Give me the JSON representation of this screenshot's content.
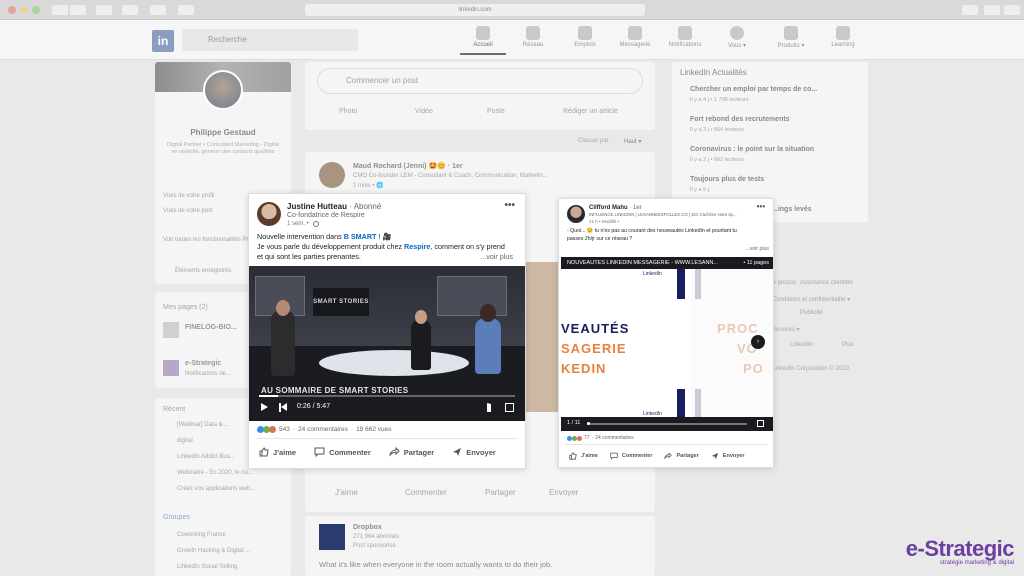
{
  "browser": {
    "url": "linkedin.com"
  },
  "linkedin": {
    "logo": "in",
    "search_placeholder": "Recherche",
    "nav": [
      {
        "label": "Accueil",
        "icon": "home-icon"
      },
      {
        "label": "Réseau",
        "icon": "network-icon"
      },
      {
        "label": "Emplois",
        "icon": "jobs-icon"
      },
      {
        "label": "Messagerie",
        "icon": "messaging-icon"
      },
      {
        "label": "Notifications",
        "icon": "bell-icon"
      },
      {
        "label": "Vous ▾",
        "icon": "avatar-icon"
      },
      {
        "label": "Produits ▾",
        "icon": "grid-icon"
      },
      {
        "label": "Learning",
        "icon": "learning-icon"
      }
    ]
  },
  "left_profile": {
    "name": "Philippe Gestaud",
    "headline": "Digital Partner • Consultant Marketing - Digital en visibilité, générer des contacts qualifiés",
    "stats": [
      "Vues de votre profil",
      "Vues de votre post"
    ],
    "premium": "Voir toutes les fonctionnalités Premium",
    "saved": "Éléments enregistrés",
    "pages_title": "Mes pages (2)",
    "pages": [
      "FINELOG-BIO...",
      "e-Strategic"
    ],
    "pages_sub": "Notifications de...",
    "recent_title": "Récent",
    "recent": [
      "[Webinar] Data & ...",
      "digital",
      "LinkedIn Addict Bus...",
      "Webinaire - En 2020, le no...",
      "Créez vos applications web..."
    ],
    "groups_title": "Groupes",
    "groups": [
      "Coworking France",
      "Growth Hacking & Digital ...",
      "LinkedIn Social Selling"
    ]
  },
  "composer": {
    "start_post": "Commencer un post",
    "photo": "Photo",
    "video": "Vidéo",
    "event": "Poste",
    "article": "Rédiger un article",
    "sort_label": "Classer par :",
    "sort_value": "Haut ▾"
  },
  "bg_post": {
    "author": "Maud Rochard (Jenni) 🤩😊 · 1er",
    "subtitle": "CMO Co-founder LEM - Consultant & Coach, Communication, Marketin...",
    "time": "1 mois • 🌐"
  },
  "bg_actions": [
    "J'aime",
    "Commenter",
    "Partager",
    "Envoyer"
  ],
  "dropbox": {
    "name": "Dropbox",
    "followers": "271 964 abonnés",
    "sponsored": "Post sponsorisé",
    "text": "What it's like when everyone in the room actually wants to do their job."
  },
  "right_news": {
    "title": "LinkedIn Actualités",
    "items": [
      {
        "title": "Chercher un emploi par temps de co...",
        "meta": "Il y a 4 j • 1 709 lecteurs"
      },
      {
        "title": "Fort rebond des recrutements",
        "meta": "Il y a 3 j • 664 lecteurs"
      },
      {
        "title": "Coronavirus : le point sur la situation",
        "meta": "Il y a 2 j • 662 lecteurs"
      },
      {
        "title": "Toujours plus de tests",
        "meta": "Il y a 5 j"
      },
      {
        "title": "...ings levés",
        "meta": ""
      }
    ],
    "footer_links": [
      "À propos",
      "Assistance clientèle",
      "Conditions et confidentialité ▾",
      "Publicité",
      "Services ▾",
      "LinkedIn",
      "Plus",
      "LinkedIn Corporation © 2020"
    ]
  },
  "post1": {
    "author": "Justine Hutteau",
    "follow": "· Abonné",
    "subtitle": "Co-fondatrice de Respire",
    "time": "1 sem. •",
    "text_line1_a": "Nouvelle intervention dans ",
    "text_line1_link": "B SMART",
    "text_line1_b": " ! 🎥",
    "text_line2_a": "Je vous parle du développement produit chez ",
    "text_line2_link": "Respire",
    "text_line2_b": ", comment on s'y prend",
    "text_line3": "et qui sont les parties prenantes.",
    "see_more": "...voir plus",
    "video_screen": "SMART STORIES",
    "video_caption": "AU SOMMAIRE DE SMART STORIES",
    "time_display": "0:26 / 5:47",
    "progress": 0.075,
    "reactions": "543",
    "comments": "24 commentaires",
    "views": "19 662 vues",
    "actions": [
      "J'aime",
      "Commenter",
      "Partager",
      "Envoyer"
    ]
  },
  "post2": {
    "author": "Clifford Mahu",
    "follow": "· 1er",
    "subtitle": "INFLUENCE LINKEDIN | LESANNEESFOLLES.CO | SCI s'achève votre sp...",
    "time": "21 h • Modifié •",
    "text_a": "- Quoi... 😏 tu n'es pas au courant des nouveautés LinkedIn et pourtant tu",
    "text_b": "passes 2h/jr sur ce réseau ?",
    "see_more": "...voir plus",
    "doc_title": "NOUVEAUTES LINKEDIN MESSAGERIE - WWW.LESANN...",
    "doc_pages": "• 11 pages",
    "slide_lines": [
      "VEAUTÉS",
      "SAGERIE",
      "KEDIN"
    ],
    "slide_next_lines": [
      "PROC",
      "VO",
      "PO"
    ],
    "doc_brand": "LinkedIn",
    "page_counter": "1 / 11",
    "reactions": "77",
    "comments": "24 commentaires",
    "actions": [
      "J'aime",
      "Commenter",
      "Partager",
      "Envoyer"
    ]
  },
  "watermark": {
    "brand": "e-Strategic",
    "tagline": "stratégie marketing & digital"
  },
  "colors": {
    "linkedin_blue": "#0a66c2",
    "watermark_purple": "#6a3fa0",
    "slide_navy": "#1b1f5e",
    "slide_orange": "#e8823a"
  }
}
